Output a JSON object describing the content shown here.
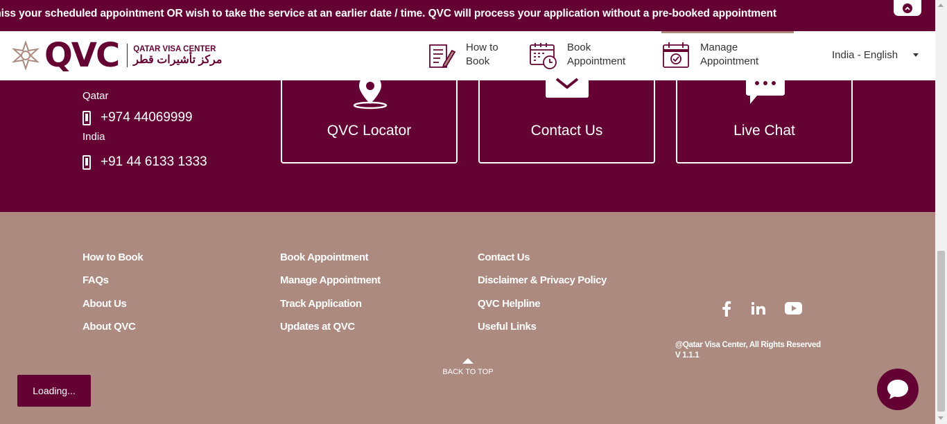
{
  "ticker": {
    "text": "miss your scheduled appointment OR wish to take the service at an earlier date / time. QVC will process your application without a pre-booked appointment"
  },
  "header": {
    "logo_word": "QVC",
    "logo_en": "QATAR VISA CENTER",
    "logo_ar": "مركز تأشيرات قطر",
    "nav": [
      {
        "line1": "How to",
        "line2": "Book",
        "icon": "form-pen-icon"
      },
      {
        "line1": "Book",
        "line2": "Appointment",
        "icon": "calendar-clock-icon"
      },
      {
        "line1": "Manage",
        "line2": "Appointment",
        "icon": "calendar-check-icon"
      }
    ],
    "language": "India - English"
  },
  "contact": {
    "qatar_label": "Qatar",
    "qatar_phone": "+974 44069999",
    "india_label": "India",
    "india_phone": "+91 44 6133 1333",
    "cards": [
      {
        "label": "QVC Locator",
        "icon": "map-pin-icon"
      },
      {
        "label": "Contact Us",
        "icon": "envelope-icon"
      },
      {
        "label": "Live Chat",
        "icon": "chat-icon"
      }
    ]
  },
  "footer": {
    "col1": [
      "How to Book",
      "FAQs",
      "About Us",
      "About QVC"
    ],
    "col2": [
      "Book Appointment",
      "Manage Appointment",
      "Track Application",
      "Updates at QVC"
    ],
    "col3": [
      "Contact Us",
      "Disclaimer & Privacy Policy",
      "QVC Helpline",
      "Useful Links"
    ],
    "social": [
      "facebook-icon",
      "linkedin-icon",
      "youtube-icon"
    ],
    "copyright": "@Qatar Visa Center, All Rights Reserved",
    "version": "V 1.1.1",
    "back_to_top": "BACK TO TOP"
  },
  "loading_label": "Loading...",
  "colors": {
    "maroon": "#640333",
    "taupe": "#ac8a7f",
    "white": "#ffffff"
  }
}
